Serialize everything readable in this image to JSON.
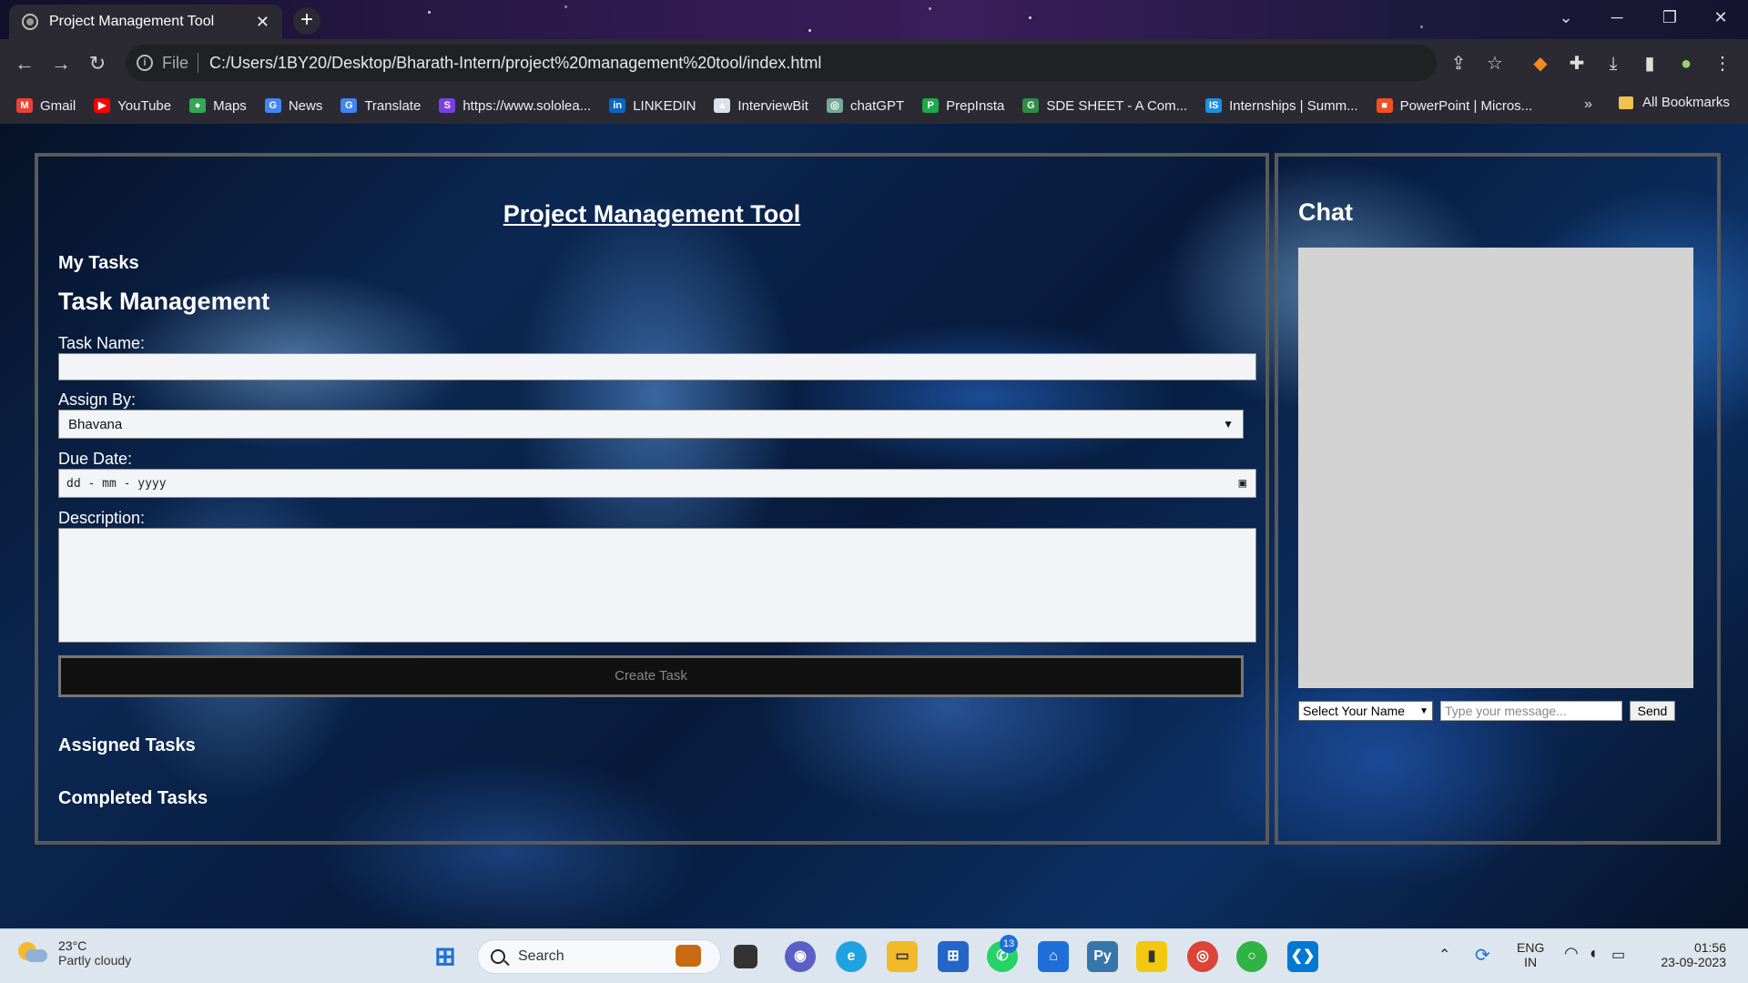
{
  "browser": {
    "tab_title": "Project Management Tool",
    "url_scheme": "File",
    "url": "C:/Users/1BY20/Desktop/Bharath-Intern/project%20management%20tool/index.html",
    "bookmarks": [
      {
        "label": "Gmail",
        "icon": "gmail-icon",
        "color": "#ea4335",
        "glyph": "M"
      },
      {
        "label": "YouTube",
        "icon": "youtube-icon",
        "color": "#ff0000",
        "glyph": "▶"
      },
      {
        "label": "Maps",
        "icon": "maps-icon",
        "color": "#34a853",
        "glyph": "●"
      },
      {
        "label": "News",
        "icon": "news-icon",
        "color": "#4285f4",
        "glyph": "G"
      },
      {
        "label": "Translate",
        "icon": "translate-icon",
        "color": "#4285f4",
        "glyph": "G"
      },
      {
        "label": "https://www.sololea...",
        "icon": "sololearn-icon",
        "color": "#7b3fe4",
        "glyph": "S"
      },
      {
        "label": "LINKEDIN",
        "icon": "linkedin-icon",
        "color": "#0a66c2",
        "glyph": "in"
      },
      {
        "label": "InterviewBit",
        "icon": "interviewbit-icon",
        "color": "#d9e1ea",
        "glyph": "▲"
      },
      {
        "label": "chatGPT",
        "icon": "chatgpt-icon",
        "color": "#74aa9c",
        "glyph": "◎"
      },
      {
        "label": "PrepInsta",
        "icon": "prepinsta-icon",
        "color": "#1fa94b",
        "glyph": "P"
      },
      {
        "label": "SDE SHEET - A Com...",
        "icon": "sde-sheet-icon",
        "color": "#2f8d46",
        "glyph": "G"
      },
      {
        "label": "Internships | Summ...",
        "icon": "internshala-icon",
        "color": "#1d8fe1",
        "glyph": "IS"
      },
      {
        "label": "PowerPoint | Micros...",
        "icon": "microsoft-icon",
        "color": "#f25022",
        "glyph": "■"
      }
    ],
    "more_bookmarks": "»",
    "all_bookmarks": "All Bookmarks"
  },
  "page": {
    "title": "Project Management Tool",
    "my_tasks": "My Tasks",
    "task_management": "Task Management",
    "task_name_label": "Task Name:",
    "task_name_value": "",
    "assign_by_label": "Assign By:",
    "assign_by_selected": "Bhavana",
    "due_date_label": "Due Date:",
    "due_date_placeholder": "dd - mm - yyyy",
    "description_label": "Description:",
    "description_value": "",
    "create_button": "Create Task",
    "assigned_tasks": "Assigned Tasks",
    "completed_tasks": "Completed Tasks"
  },
  "chat": {
    "title": "Chat",
    "name_select": "Select Your Name",
    "message_placeholder": "Type your message...",
    "send_button": "Send"
  },
  "taskbar": {
    "temperature": "23°C",
    "weather": "Partly cloudy",
    "search_label": "Search",
    "whatsapp_badge": "13",
    "language_line1": "ENG",
    "language_line2": "IN",
    "time": "01:56",
    "date": "23-09-2023"
  },
  "colors": {
    "panel_border": "#5a5a5a",
    "chat_box": "#d3d3d3",
    "create_button_bg": "#111111"
  }
}
